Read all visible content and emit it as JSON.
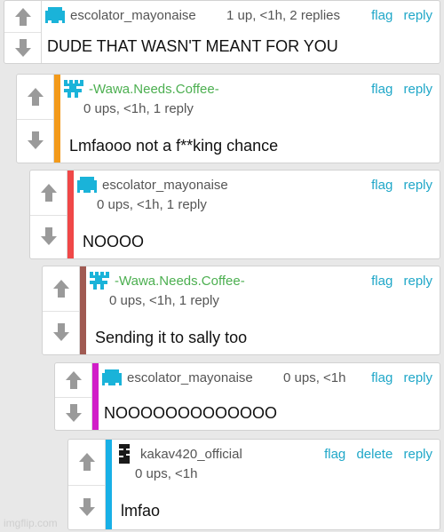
{
  "icons": {
    "upvote": "upvote-arrow-icon",
    "downvote": "downvote-arrow-icon"
  },
  "colors": {
    "link": "#1fa7c8",
    "wawa_username": "#4caf50",
    "escolator_avatar": "#1ab3d9",
    "accent_1": "#f39a1a",
    "accent_2": "#f04848",
    "accent_3": "#a05a52",
    "accent_4": "#d11dc8",
    "accent_5": "#18b0e6"
  },
  "comments": [
    {
      "username": "escolator_mayonaise",
      "meta": "1 up, <1h, 2 replies",
      "text": "DUDE THAT WASN'T MEANT FOR YOU",
      "actions": {
        "flag": "flag",
        "reply": "reply"
      }
    },
    {
      "username": "-Wawa.Needs.Coffee-",
      "meta": "0 ups, <1h, 1 reply",
      "text": "Lmfaooo not a f**king chance",
      "actions": {
        "flag": "flag",
        "reply": "reply"
      }
    },
    {
      "username": "escolator_mayonaise",
      "meta": "0 ups, <1h, 1 reply",
      "text": "NOOOO",
      "actions": {
        "flag": "flag",
        "reply": "reply"
      }
    },
    {
      "username": "-Wawa.Needs.Coffee-",
      "meta": "0 ups, <1h, 1 reply",
      "text": "Sending it to sally too",
      "actions": {
        "flag": "flag",
        "reply": "reply"
      }
    },
    {
      "username": "escolator_mayonaise",
      "meta": "0 ups, <1h",
      "text": "NOOOOOOOOOOOOO",
      "actions": {
        "flag": "flag",
        "reply": "reply"
      }
    },
    {
      "username": "kakav420_official",
      "meta": "0 ups, <1h",
      "text": "lmfao",
      "actions": {
        "flag": "flag",
        "delete": "delete",
        "reply": "reply"
      }
    }
  ],
  "footer": {
    "watermark": "imgflip.com"
  }
}
